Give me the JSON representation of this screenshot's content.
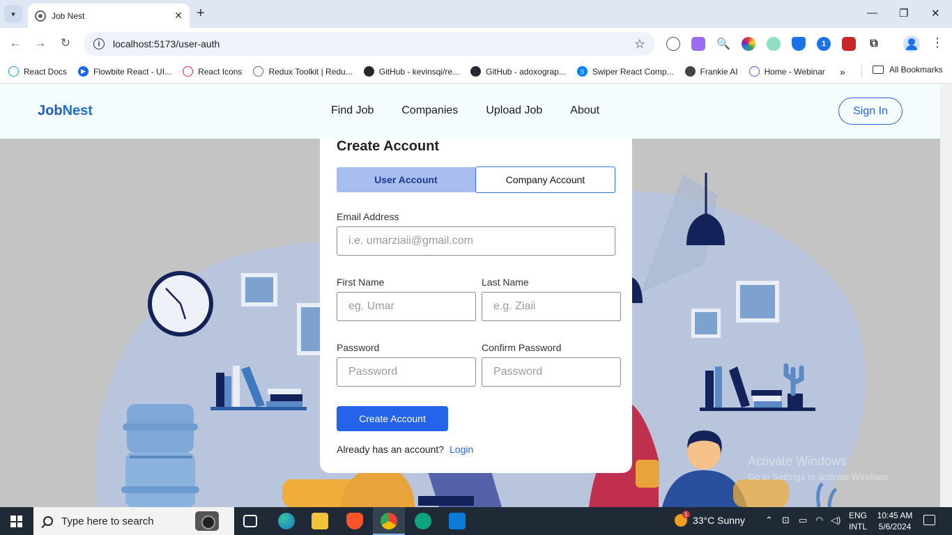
{
  "browser": {
    "tab_title": "Job Nest",
    "url": "localhost:5173/user-auth",
    "bookmarks": [
      {
        "label": "React Docs",
        "color": "#149eca"
      },
      {
        "label": "Flowbite React - UI...",
        "color": "#1c64f2"
      },
      {
        "label": "React Icons",
        "color": "#e91e63"
      },
      {
        "label": "Redux Toolkit | Redu...",
        "color": "#764abc"
      },
      {
        "label": "GitHub - kevinsqi/re...",
        "color": "#24292f"
      },
      {
        "label": "GitHub - adoxograp...",
        "color": "#24292f"
      },
      {
        "label": "Swiper React Comp...",
        "color": "#0080ff"
      },
      {
        "label": "Frankie AI",
        "color": "#444444"
      },
      {
        "label": "Home - Webinar",
        "color": "#3b5bdb"
      }
    ],
    "all_bookmarks": "All Bookmarks"
  },
  "site": {
    "logo_a": "Job",
    "logo_b": "Nest",
    "nav": [
      "Find Job",
      "Companies",
      "Upload Job",
      "About"
    ],
    "signin": "Sign In"
  },
  "form": {
    "title": "Create Account",
    "tab_user": "User Account",
    "tab_company": "Company Account",
    "email_label": "Email Address",
    "email_placeholder": "i.e. umarziaii@gmail.com",
    "first_label": "First Name",
    "first_placeholder": "eg. Umar",
    "last_label": "Last Name",
    "last_placeholder": "e.g. Ziaii",
    "password_label": "Password",
    "password_placeholder": "Password",
    "confirm_label": "Confirm Password",
    "confirm_placeholder": "Password",
    "submit": "Create Account",
    "already": "Already has an account?",
    "login": "Login"
  },
  "watermark": {
    "line1": "Activate Windows",
    "line2": "Go to Settings to activate Windows."
  },
  "taskbar": {
    "search_placeholder": "Type here to search",
    "weather": "33°C  Sunny",
    "weather_badge": "1",
    "lang1": "ENG",
    "lang2": "INTL",
    "time": "10:45 AM",
    "date": "5/6/2024"
  },
  "colors": {
    "brand": "#2563eb",
    "user_tab_bg": "#a8bdf0",
    "navy": "#13235a",
    "illustration_blue": "#b9c6de"
  }
}
